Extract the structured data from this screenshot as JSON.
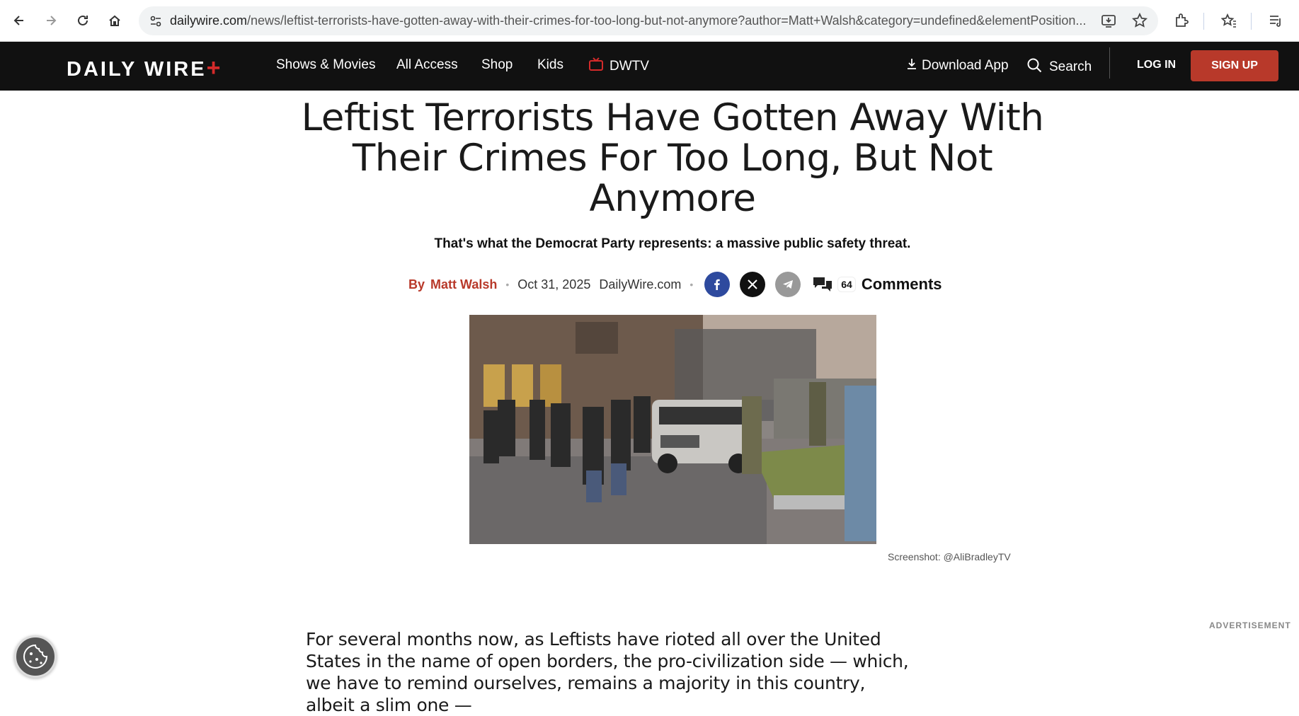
{
  "browser": {
    "url_host": "dailywire.com",
    "url_path": "/news/leftist-terrorists-have-gotten-away-with-their-crimes-for-too-long-but-not-anymore?author=Matt+Walsh&category=undefined&elementPosition..."
  },
  "header": {
    "logo_text": "DAILY WIRE",
    "logo_plus": "+",
    "nav": [
      "Shows & Movies",
      "All Access",
      "Shop",
      "Kids",
      "DWTV"
    ],
    "download_app": "Download App",
    "search": "Search",
    "login": "LOG IN",
    "signup": "SIGN UP"
  },
  "article": {
    "headline": "Leftist Terrorists Have Gotten Away With Their Crimes For Too Long, But Not Anymore",
    "subhead": "That's what the Democrat Party represents: a massive public safety threat.",
    "by_label": "By",
    "author": "Matt Walsh",
    "date": "Oct 31, 2025",
    "source": "DailyWire.com",
    "comment_count": "64",
    "comments_label": "Comments",
    "image_caption": "Screenshot: @AliBradleyTV",
    "body": "For several months now, as Leftists have rioted all over the United States in the name of open borders, the pro-civilization side — which, we have to remind ourselves, remains a majority in this country, albeit a slim one —"
  },
  "advertisement_label": "ADVERTISEMENT",
  "colors": {
    "brand_red": "#b8392a",
    "header_bg": "#111111",
    "facebook": "#2e4a9e"
  }
}
